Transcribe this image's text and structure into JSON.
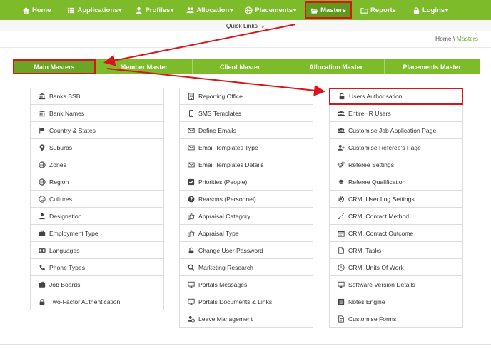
{
  "nav": [
    {
      "label": "Home",
      "icon": "home-icon",
      "caret": ""
    },
    {
      "label": "Applications",
      "icon": "list-icon",
      "caret": "▾"
    },
    {
      "label": "Profiles",
      "icon": "user-icon",
      "caret": "▾"
    },
    {
      "label": "Allocation",
      "icon": "people-icon",
      "caret": "▾"
    },
    {
      "label": "Placements",
      "icon": "globe-icon",
      "caret": "▾"
    },
    {
      "label": "Masters",
      "icon": "folder-open-icon",
      "caret": ""
    },
    {
      "label": "Reports",
      "icon": "folder-icon",
      "caret": ""
    },
    {
      "label": "Logins",
      "icon": "lock-icon",
      "caret": "▾"
    }
  ],
  "quick_links": {
    "label": "Quick Links",
    "chevron": "⌄"
  },
  "breadcrumb": {
    "home": "Home",
    "sep": " \\ ",
    "current": "Masters"
  },
  "tabs": [
    "Main Masters",
    "Member Master",
    "Client Master",
    "Allocation Master",
    "Placements Master"
  ],
  "columns": [
    [
      {
        "label": "Banks BSB",
        "icon": "bank-icon"
      },
      {
        "label": "Bank Names",
        "icon": "bank-icon"
      },
      {
        "label": "Country & States",
        "icon": "flag-icon"
      },
      {
        "label": "Suburbs",
        "icon": "map-marker-icon"
      },
      {
        "label": "Zones",
        "icon": "globe-icon"
      },
      {
        "label": "Region",
        "icon": "globe-icon"
      },
      {
        "label": "Cultures",
        "icon": "smile-icon"
      },
      {
        "label": "Designation",
        "icon": "user-icon"
      },
      {
        "label": "Employment Type",
        "icon": "briefcase-icon"
      },
      {
        "label": "Languages",
        "icon": "language-icon"
      },
      {
        "label": "Phone Types",
        "icon": "phone-icon"
      },
      {
        "label": "Job Boards",
        "icon": "briefcase-icon"
      },
      {
        "label": "Two-Factor Authentication",
        "icon": "lock-icon"
      }
    ],
    [
      {
        "label": "Reporting Office",
        "icon": "building-icon"
      },
      {
        "label": "SMS Templates",
        "icon": "mobile-icon"
      },
      {
        "label": "Define Emails",
        "icon": "envelope-icon"
      },
      {
        "label": "Email Templates Type",
        "icon": "envelope-icon"
      },
      {
        "label": "Email Templates Details",
        "icon": "envelope-icon"
      },
      {
        "label": "Priorities (People)",
        "icon": "check-square-icon"
      },
      {
        "label": "Reasons (Personnel)",
        "icon": "question-circle-icon"
      },
      {
        "label": "Appraisal Category",
        "icon": "thumbs-up-icon"
      },
      {
        "label": "Appraisal Type",
        "icon": "thumbs-up-icon"
      },
      {
        "label": "Change User Password",
        "icon": "unlock-icon"
      },
      {
        "label": "Marketing Research",
        "icon": "search-icon"
      },
      {
        "label": "Portals Messages",
        "icon": "monitor-icon"
      },
      {
        "label": "Portals Documents & Links",
        "icon": "monitor-icon"
      },
      {
        "label": "Leave Management",
        "icon": "user-clock-icon"
      }
    ],
    [
      {
        "label": "Users Authorisation",
        "icon": "unlock-icon"
      },
      {
        "label": "EntireHR Users",
        "icon": "users-icon"
      },
      {
        "label": "Customise Job Application Page",
        "icon": "users-icon"
      },
      {
        "label": "Customise Referee's Page",
        "icon": "user-plus-icon"
      },
      {
        "label": "Referee Settings",
        "icon": "cogs-icon"
      },
      {
        "label": "Referee Qualification",
        "icon": "graduation-cap-icon"
      },
      {
        "label": "CRM, User Log Settings",
        "icon": "cog-icon"
      },
      {
        "label": "CRM, Contact Method",
        "icon": "brush-icon"
      },
      {
        "label": "CRM, Contact Outcome",
        "icon": "calendar-icon"
      },
      {
        "label": "CRM, Tasks",
        "icon": "file-icon"
      },
      {
        "label": "CRM, Units Of Work",
        "icon": "clock-icon"
      },
      {
        "label": "Software Version Details",
        "icon": "monitor-icon"
      },
      {
        "label": "Notes Engine",
        "icon": "list-icon"
      },
      {
        "label": "Customise Forms",
        "icon": "file-text-icon"
      }
    ]
  ],
  "colors": {
    "brand_green": "#7dbb2b",
    "annotation_red": "#d9151b"
  }
}
